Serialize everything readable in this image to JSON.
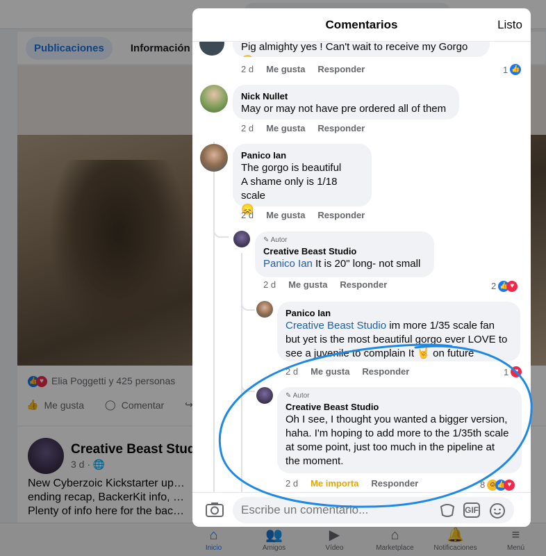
{
  "background": {
    "tabs": [
      "Publicaciones",
      "Información"
    ],
    "reactions_text": "Elia Poggetti y 425 personas",
    "actions": [
      "Me gusta",
      "Comentar"
    ],
    "post": {
      "name": "Creative Beast Studio",
      "meta": "3 d · ",
      "text": "New Cyberzoic Kickstarter up… ending recap, BackerKit info, … Plenty of info here for the bac…"
    },
    "nav": [
      {
        "icon": "home-icon",
        "label": "Inicio"
      },
      {
        "icon": "friends-icon",
        "label": "Amigos"
      },
      {
        "icon": "video-icon",
        "label": "Vídeo"
      },
      {
        "icon": "marketplace-icon",
        "label": "Marketplace"
      },
      {
        "icon": "bell-icon",
        "label": "Notificaciones"
      },
      {
        "icon": "menu-icon",
        "label": "Menú"
      }
    ]
  },
  "modal": {
    "title": "Comentarios",
    "done": "Listo"
  },
  "comments": [
    {
      "partial_text": "Pig almighty yes ! Can't wait to receive my Gorgo 😊",
      "time": "2 d",
      "like": "Me gusta",
      "reply": "Responder",
      "count": "1"
    },
    {
      "name": "Nick Nullet",
      "text": "May or may not have pre ordered all of them",
      "time": "2 d",
      "like": "Me gusta",
      "reply": "Responder"
    },
    {
      "name": "Panico Ian",
      "text_lines": [
        "The gorgo is beautiful",
        "A shame only is 1/18 scale",
        "😞"
      ],
      "time": "2 d",
      "like": "Me gusta",
      "reply": "Responder"
    },
    {
      "author_tag": "Autor",
      "name": "Creative Beast Studio",
      "mention": "Panico Ian",
      "text": " It is 20\" long- not small",
      "time": "2 d",
      "like": "Me gusta",
      "reply": "Responder",
      "count": "2"
    },
    {
      "name": "Panico Ian",
      "mention": "Creative Beast Studio",
      "text_lines": [
        " im more 1/35 scale fan",
        "but yet is the most beautiful gorgo ever LOVE to",
        "see a juvenile to complain It 🤘 on future"
      ],
      "time": "2 d",
      "like": "Me gusta",
      "reply": "Responder",
      "count": "1"
    },
    {
      "author_tag": "Autor",
      "name": "Creative Beast Studio",
      "text_lines": [
        "Oh I see, I thought you wanted a bigger version,",
        "haha. I'm hoping to add more to the 1/35th scale",
        "at some point, just too much in the pipeline at",
        "the moment."
      ],
      "time": "2 d",
      "like": "Me importa",
      "reply": "Responder",
      "count": "8"
    }
  ],
  "composer": {
    "placeholder": "Escribe un comentario...",
    "gif": "GIF"
  },
  "colors": {
    "accent": "#1877f2",
    "love": "#f02849",
    "care": "#e0a800",
    "annotation": "#1e88e5"
  }
}
